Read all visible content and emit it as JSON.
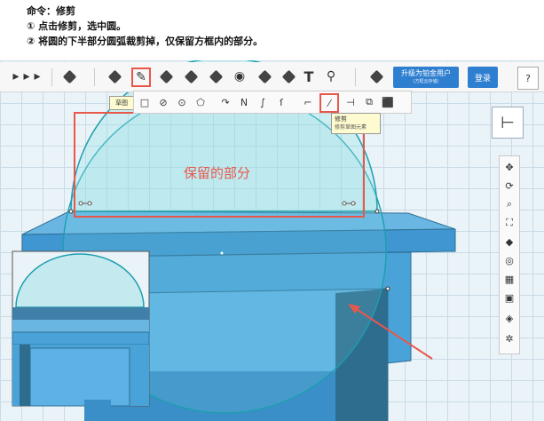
{
  "instructions": {
    "title": "命令：修剪",
    "step1": "① 点击修剪，选中圆。",
    "step2": "② 将圆的下半部分圆弧裁剪掉，仅保留方框内的部分。"
  },
  "toolbar": {
    "upgrade_label": "升级为铂金用户",
    "upgrade_sub": "(方框云存储)",
    "login_label": "登录",
    "help_label": "?",
    "text_tool_glyph": "T"
  },
  "sketch_tooltip": "草图",
  "trim_tooltip": {
    "title": "修剪",
    "desc": "修剪草图元素"
  },
  "annotation": {
    "keep_label": "保留的部分"
  },
  "colors": {
    "accent_red": "#e8584a",
    "box_blue": "#4aa3d8",
    "box_dark": "#2f6d8e",
    "circle_stroke": "#1b9fae",
    "grid": "#c9dbe6"
  }
}
